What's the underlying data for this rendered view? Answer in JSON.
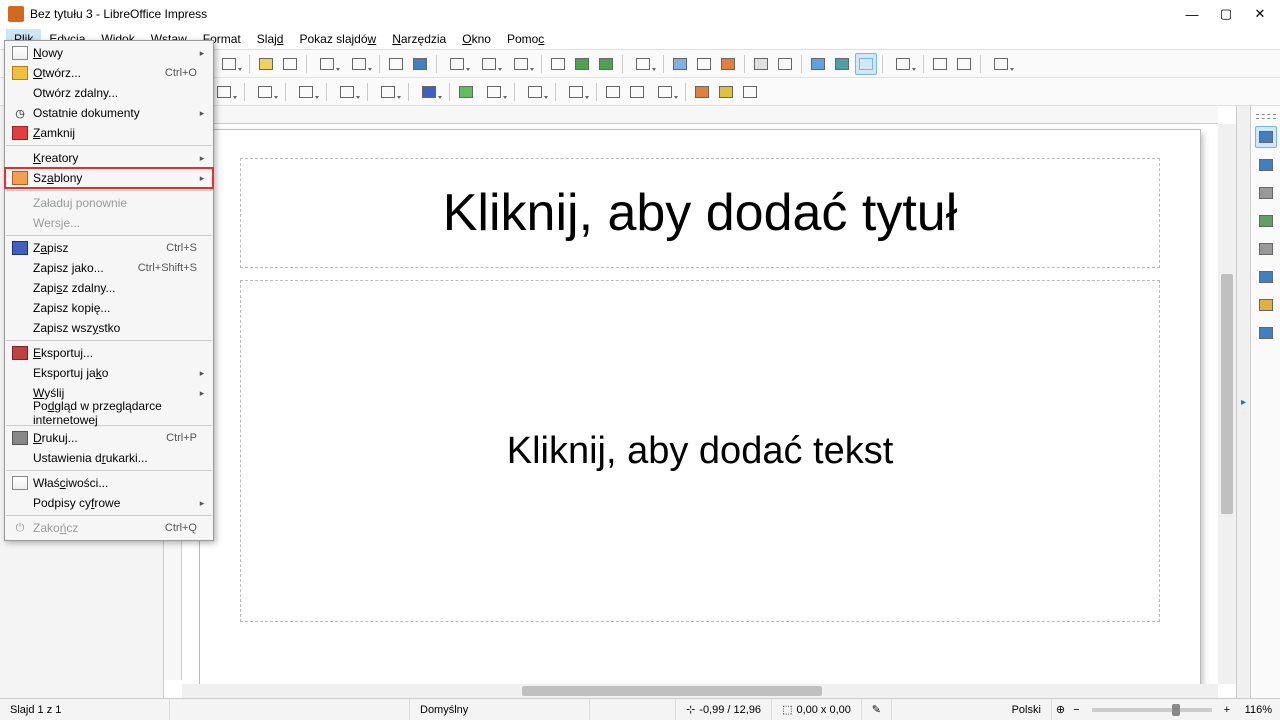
{
  "window": {
    "title": "Bez tytułu 3 - LibreOffice Impress"
  },
  "menubar": [
    {
      "label": "Plik",
      "ul": "P",
      "rest": "lik",
      "active": true
    },
    {
      "label": "Edycja",
      "ul": "E",
      "rest": "dycja"
    },
    {
      "label": "Widok",
      "ul": "W",
      "rest": "idok"
    },
    {
      "label": "Wstaw",
      "ul": "",
      "rest": "Wsta",
      "ul2": "w"
    },
    {
      "label": "Format",
      "ul": "F",
      "rest": "ormat"
    },
    {
      "label": "Slajd",
      "ul": "",
      "rest": "Slaj",
      "ul2": "d"
    },
    {
      "label": "Pokaz slajdów",
      "ul": "",
      "rest": "Pokaz slajdó",
      "ul2": "w"
    },
    {
      "label": "Narzędzia",
      "ul": "N",
      "rest": "arzędzia"
    },
    {
      "label": "Okno",
      "ul": "O",
      "rest": "kno"
    },
    {
      "label": "Pomoc",
      "ul": "",
      "rest": "Pomo",
      "ul2": "c"
    }
  ],
  "file_menu": {
    "groups": [
      [
        {
          "icon": "doc",
          "label": "Nowy",
          "ul": "N",
          "rest": "owy",
          "submenu": true
        },
        {
          "icon": "folder",
          "label": "Otwórz...",
          "ul": "O",
          "rest": "twórz...",
          "shortcut": "Ctrl+O"
        },
        {
          "label": "Otwórz zdalny...",
          "ul": "",
          "plain": "Otwórz zdalny..."
        },
        {
          "icon": "clock",
          "label": "Ostatnie dokumenty",
          "ul": "",
          "plain": "Ostatnie dokumenty",
          "submenu": true
        },
        {
          "icon": "close",
          "label": "Zamknij",
          "ul": "Z",
          "rest": "amknij"
        }
      ],
      [
        {
          "label": "Kreatory",
          "ul": "K",
          "rest": "reatory",
          "submenu": true
        },
        {
          "icon": "tpl",
          "label": "Szablony",
          "ul": "",
          "pre": "Sz",
          "ul2": "a",
          "rest": "blony",
          "submenu": true,
          "highlighted": true
        }
      ],
      [
        {
          "label": "Załaduj ponownie",
          "plain": "Załaduj ponownie",
          "disabled": true
        },
        {
          "label": "Wersje...",
          "ul": "",
          "plain": "Wersje...",
          "disabled": true
        }
      ],
      [
        {
          "icon": "save",
          "label": "Zapisz",
          "ul": "",
          "pre": "Z",
          "ul2": "a",
          "rest": "pisz",
          "shortcut": "Ctrl+S"
        },
        {
          "label": "Zapisz jako...",
          "ul": "",
          "pre": "Zapisz ",
          "ul2": "j",
          "rest": "ako...",
          "shortcut": "Ctrl+Shift+S"
        },
        {
          "label": "Zapisz zdalny...",
          "ul": "",
          "pre": "Zapi",
          "ul2": "s",
          "rest": "z zdalny..."
        },
        {
          "label": "Zapisz kopię...",
          "plain": "Zapisz kopię..."
        },
        {
          "label": "Zapisz wszystko",
          "ul": "",
          "pre": "Zapisz wsz",
          "ul2": "y",
          "rest": "stko"
        }
      ],
      [
        {
          "icon": "export",
          "label": "Eksportuj...",
          "ul": "E",
          "rest": "ksportuj..."
        },
        {
          "label": "Eksportuj jako",
          "ul": "",
          "pre": "Eksportuj ja",
          "ul2": "k",
          "rest": "o",
          "submenu": true
        },
        {
          "label": "Wyślij",
          "ul": "W",
          "rest": "yślij",
          "submenu": true
        },
        {
          "label": "Podgląd w przeglądarce internetowej",
          "ul": "",
          "pre": "Po",
          "ul2": "d",
          "rest": "gląd w przeglądarce internetowej"
        }
      ],
      [
        {
          "icon": "print",
          "label": "Drukuj...",
          "ul": "D",
          "rest": "rukuj...",
          "shortcut": "Ctrl+P"
        },
        {
          "label": "Ustawienia drukarki...",
          "ul": "",
          "pre": "Ustawienia d",
          "ul2": "r",
          "rest": "ukarki..."
        }
      ],
      [
        {
          "icon": "doc",
          "label": "Właściwości...",
          "ul": "",
          "pre": "Właś",
          "ul2": "c",
          "rest": "iwości..."
        },
        {
          "label": "Podpisy cyfrowe",
          "ul": "",
          "pre": "Podpisy cy",
          "ul2": "f",
          "rest": "rowe",
          "submenu": true
        }
      ],
      [
        {
          "icon": "exit",
          "label": "Zakończ",
          "ul": "",
          "pre": "Zako",
          "ul2": "ń",
          "rest": "cz",
          "shortcut": "Ctrl+Q",
          "disabled": true
        }
      ]
    ]
  },
  "slide": {
    "title_placeholder": "Kliknij, aby dodać tytuł",
    "text_placeholder": "Kliknij, aby dodać tekst"
  },
  "status": {
    "slide_n": "Slajd 1 z 1",
    "master": "Domyślny",
    "coords": "-0,99 / 12,96",
    "size": "0,00 x 0,00",
    "lang": "Polski",
    "zoom": "116%"
  },
  "right_panel_icons": [
    "properties",
    "styles",
    "gallery",
    "navigator",
    "shapes",
    "slide-transition",
    "animation",
    "master-slides"
  ]
}
